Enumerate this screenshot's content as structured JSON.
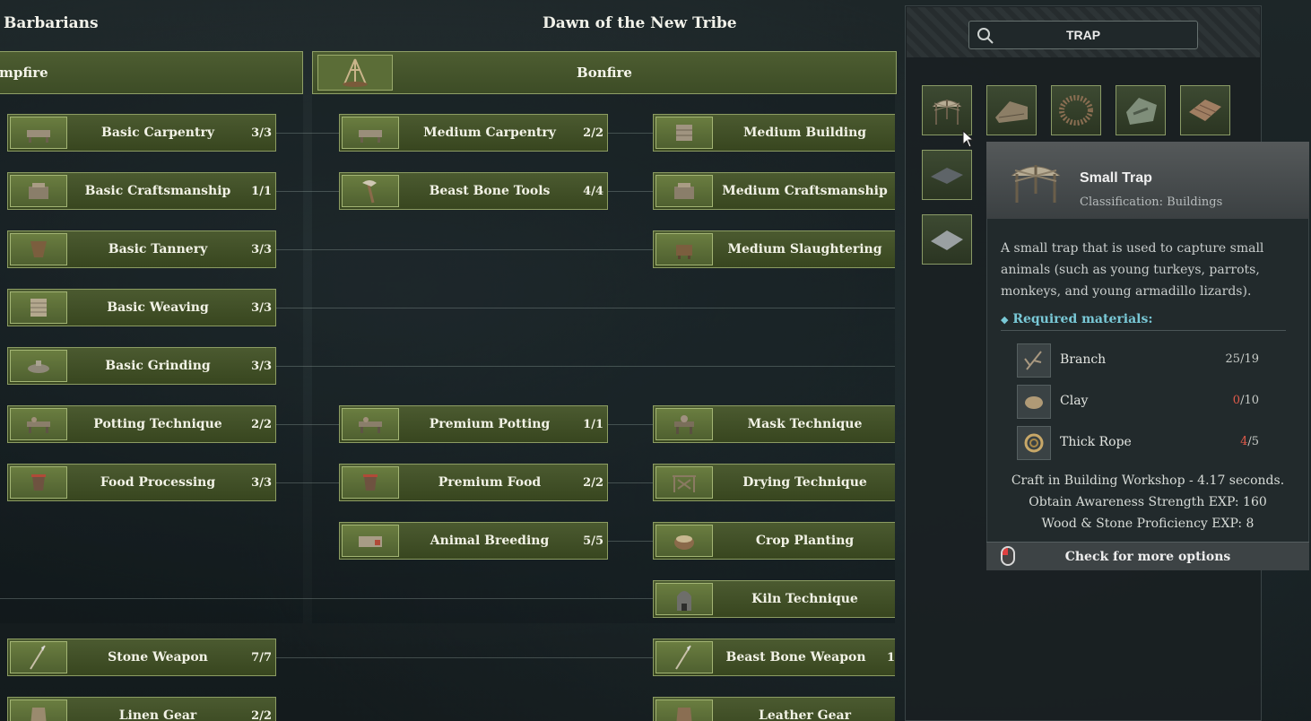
{
  "eras": {
    "left_title": "Barbarians",
    "center_title": "Dawn of the New Tribe"
  },
  "stages": {
    "left": "mpfire",
    "center": "Bonfire"
  },
  "col1": [
    {
      "label": "Basic Carpentry",
      "count": "3/3",
      "icon": "carpentry-icon"
    },
    {
      "label": "Basic Craftsmanship",
      "count": "1/1",
      "icon": "craftsmanship-icon"
    },
    {
      "label": "Basic Tannery",
      "count": "3/3",
      "icon": "tannery-icon"
    },
    {
      "label": "Basic Weaving",
      "count": "3/3",
      "icon": "weaving-icon"
    },
    {
      "label": "Basic Grinding",
      "count": "3/3",
      "icon": "grinding-icon"
    },
    {
      "label": "Potting Technique",
      "count": "2/2",
      "icon": "potting-icon"
    },
    {
      "label": "Food Processing",
      "count": "3/3",
      "icon": "food-icon"
    },
    {
      "label": "Stone Weapon",
      "count": "7/7",
      "icon": "spear-icon"
    },
    {
      "label": "Linen Gear",
      "count": "2/2",
      "icon": "gear-icon"
    }
  ],
  "col2": [
    {
      "label": "Medium Carpentry",
      "count": "2/2",
      "icon": "carpentry-icon"
    },
    {
      "label": "Beast Bone Tools",
      "count": "4/4",
      "icon": "axe-icon"
    },
    {
      "label": "Premium Potting",
      "count": "1/1",
      "icon": "potting-icon"
    },
    {
      "label": "Premium Food",
      "count": "2/2",
      "icon": "food-icon"
    },
    {
      "label": "Animal Breeding",
      "count": "5/5",
      "icon": "breeding-icon"
    }
  ],
  "col3": [
    {
      "label": "Medium Building",
      "icon": "building-icon"
    },
    {
      "label": "Medium Craftsmanship",
      "icon": "craftsmanship-icon"
    },
    {
      "label": "Medium Slaughtering",
      "icon": "slaughter-icon"
    },
    {
      "label": "Mask Technique",
      "icon": "mask-icon"
    },
    {
      "label": "Drying Technique",
      "icon": "drying-icon"
    },
    {
      "label": "Crop Planting",
      "icon": "crop-icon"
    },
    {
      "label": "Kiln Technique",
      "icon": "kiln-icon"
    },
    {
      "label": "Beast Bone Weapon",
      "count": "1",
      "icon": "spear-icon"
    },
    {
      "label": "Leather Gear",
      "icon": "gear-icon"
    }
  ],
  "search": {
    "value": "TRAP"
  },
  "results": [
    {
      "name": "small-trap-slot",
      "icon": "trap-icon"
    },
    {
      "name": "shelter-slot",
      "icon": "shelter-icon"
    },
    {
      "name": "fence-slot",
      "icon": "fence-icon"
    },
    {
      "name": "pit-slot",
      "icon": "pit-icon"
    },
    {
      "name": "floor-slot",
      "icon": "wood-floor-icon"
    },
    {
      "name": "stone-floor-slot",
      "icon": "stone-floor-icon"
    },
    {
      "name": "stone-floor-2-slot",
      "icon": "stone-floor-icon"
    }
  ],
  "tooltip": {
    "title": "Small Trap",
    "classification": "Classification: Buildings",
    "description": "A small trap that is used to capture small animals (such as young turkeys, parrots, monkeys, and young armadillo lizards).",
    "required_title": "Required materials:",
    "materials": [
      {
        "name": "Branch",
        "have": "25",
        "need": "/19",
        "sufficient": true,
        "icon": "branch-icon"
      },
      {
        "name": "Clay",
        "have": "0",
        "need": "/10",
        "sufficient": false,
        "icon": "clay-icon"
      },
      {
        "name": "Thick Rope",
        "have": "4",
        "need": "/5",
        "sufficient": false,
        "icon": "rope-icon"
      }
    ],
    "craft_info": [
      "Craft in Building Workshop - 4.17 seconds.",
      "Obtain Awareness Strength EXP: 160",
      "Wood & Stone Proficiency EXP: 8"
    ],
    "more_options": "Check for more options"
  },
  "colors": {
    "node_bg": "#4b5a30",
    "node_border": "#8c9c62",
    "accent_cyan": "#79c8d6",
    "insufficient_red": "#e05a4a"
  }
}
